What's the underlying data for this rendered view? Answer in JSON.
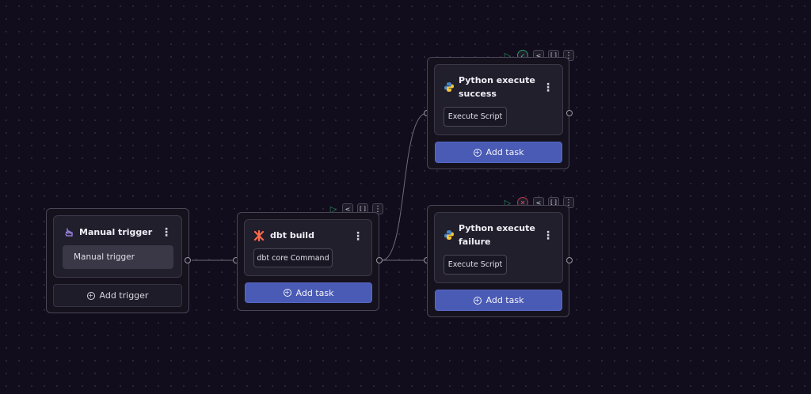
{
  "nodes": {
    "manual_trigger": {
      "title": "Manual trigger",
      "chip": "Manual trigger",
      "button": "Add trigger",
      "icon": "hand-pointer-icon"
    },
    "dbt_build": {
      "title": "dbt build",
      "chip": "dbt core Command",
      "button": "Add task",
      "icon": "dbt-logo-icon"
    },
    "python_success": {
      "title_line1": "Python execute",
      "title_line2": "success",
      "chip": "Execute Script",
      "button": "Add task",
      "icon": "python-logo-icon",
      "status": "success-icon"
    },
    "python_failure": {
      "title_line1": "Python execute",
      "title_line2": "failure",
      "chip": "Execute Script",
      "button": "Add task",
      "icon": "python-logo-icon",
      "status": "error-icon"
    }
  },
  "toolbar": {
    "play": "▷",
    "branch": "<",
    "brackets": "[ ]",
    "more": "⋮"
  },
  "colors": {
    "background": "#110d1c",
    "accent_button": "#4a5bb5",
    "success": "#3fc48a",
    "error": "#e0566a"
  }
}
